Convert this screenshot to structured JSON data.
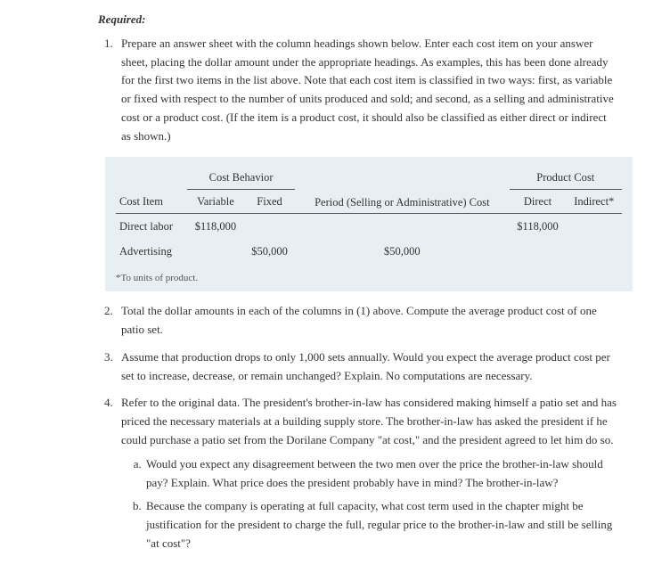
{
  "header": {
    "required_label": "Required:"
  },
  "items": {
    "q1": "Prepare an answer sheet with the column headings shown below. Enter each cost item on your answer sheet, placing the dollar amount under the appropriate headings. As examples, this has been done already for the first two items in the list above. Note that each cost item is classified in two ways: first, as variable or fixed with respect to the number of units produced and sold; and second, as a selling and administrative cost or a product cost. (If the item is a product cost, it should also be classified as either direct or indirect as shown.)",
    "q2": "Total the dollar amounts in each of the columns in (1) above. Compute the average product cost of one patio set.",
    "q3": "Assume that production drops to only 1,000 sets annually. Would you expect the average product cost per set to increase, decrease, or remain unchanged? Explain. No computations are necessary.",
    "q4": "Refer to the original data. The president's brother-in-law has considered making himself a patio set and has priced the necessary materials at a building supply store. The brother-in-law has asked the president if he could purchase a patio set from the Dorilane Company \"at cost,\" and the president agreed to let him do so.",
    "q4a": "Would you expect any disagreement between the two men over the price the brother-in-law should pay? Explain. What price does the president probably have in mind? The brother-in-law?",
    "q4b": "Because the company is operating at full capacity, what cost term used in the chapter might be justification for the president to charge the full, regular price to the brother-in-law and still be selling \"at cost\"?"
  },
  "table": {
    "group_headers": {
      "cost_behavior": "Cost Behavior",
      "period": "Period (Selling or Administrative) Cost",
      "product": "Product Cost"
    },
    "sub_headers": {
      "cost_item": "Cost Item",
      "variable": "Variable",
      "fixed": "Fixed",
      "direct": "Direct",
      "indirect": "Indirect*"
    },
    "rows": [
      {
        "item": "Direct labor",
        "variable": "$118,000",
        "fixed": "",
        "period": "",
        "direct": "$118,000",
        "indirect": ""
      },
      {
        "item": "Advertising",
        "variable": "",
        "fixed": "$50,000",
        "period": "$50,000",
        "direct": "",
        "indirect": ""
      }
    ],
    "footnote": "*To units of product."
  },
  "chart_data": {
    "type": "table",
    "title": "Cost classification answer sheet",
    "columns": [
      "Cost Item",
      "Variable",
      "Fixed",
      "Period (Selling or Administrative) Cost",
      "Direct",
      "Indirect"
    ],
    "rows": [
      [
        "Direct labor",
        118000,
        null,
        null,
        118000,
        null
      ],
      [
        "Advertising",
        null,
        50000,
        50000,
        null,
        null
      ]
    ]
  }
}
